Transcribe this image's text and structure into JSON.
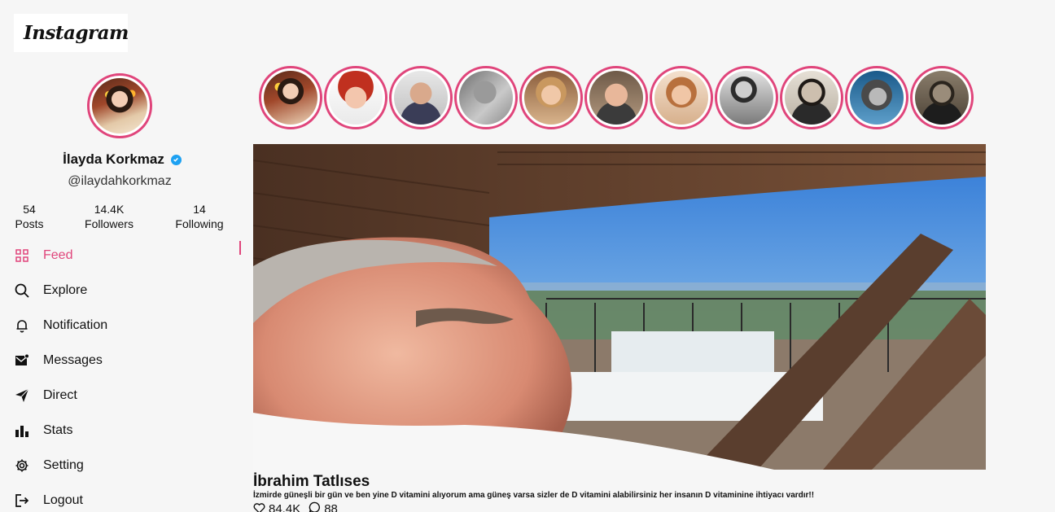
{
  "app": {
    "logo": "Instagram"
  },
  "profile": {
    "name": "İlayda Korkmaz",
    "handle": "@ilaydahkorkmaz",
    "verified": true,
    "stats": [
      {
        "value": "54",
        "label": "Posts"
      },
      {
        "value": "14.4K",
        "label": "Followers"
      },
      {
        "value": "14",
        "label": "Following"
      }
    ]
  },
  "nav": {
    "items": [
      {
        "label": "Feed",
        "icon": "grid-icon",
        "active": true
      },
      {
        "label": "Explore",
        "icon": "search-icon"
      },
      {
        "label": "Notification",
        "icon": "bell-icon"
      },
      {
        "label": "Messages",
        "icon": "mail-icon"
      },
      {
        "label": "Direct",
        "icon": "send-icon"
      },
      {
        "label": "Stats",
        "icon": "bar-chart-icon"
      },
      {
        "label": "Setting",
        "icon": "gear-icon"
      },
      {
        "label": "Logout",
        "icon": "logout-icon"
      }
    ]
  },
  "stories": {
    "count": 11
  },
  "post": {
    "title": "İbrahim Tatlıses",
    "caption": "İzmirde güneşli bir gün ve ben yine D vitamini alıyorum ama güneş varsa sizler de D vitamini alabilirsiniz her insanın D vitaminine ihtiyacı vardır!!",
    "likes": "84.4K",
    "comments": "88"
  },
  "colors": {
    "accent": "#e0457b",
    "verified": "#1da1f2",
    "background": "#f6f6f6"
  }
}
